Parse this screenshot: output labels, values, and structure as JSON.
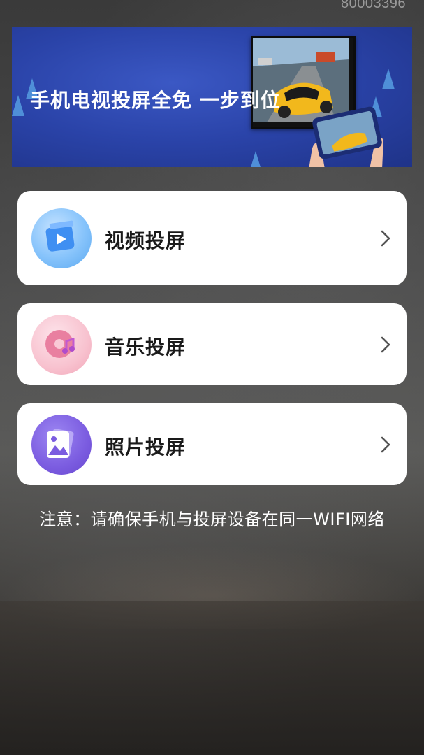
{
  "status": {
    "id_text": "80003396"
  },
  "banner": {
    "title": "手机电视投屏全免  一步到位"
  },
  "menu": {
    "items": [
      {
        "label": "视频投屏",
        "icon": "video-icon",
        "color": "#5aa8f0"
      },
      {
        "label": "音乐投屏",
        "icon": "music-disc-icon",
        "color": "#f4a6b6"
      },
      {
        "label": "照片投屏",
        "icon": "photo-icon",
        "color": "#7b5ce0"
      }
    ]
  },
  "notice": {
    "text": "注意：请确保手机与投屏设备在同一WIFI网络"
  }
}
